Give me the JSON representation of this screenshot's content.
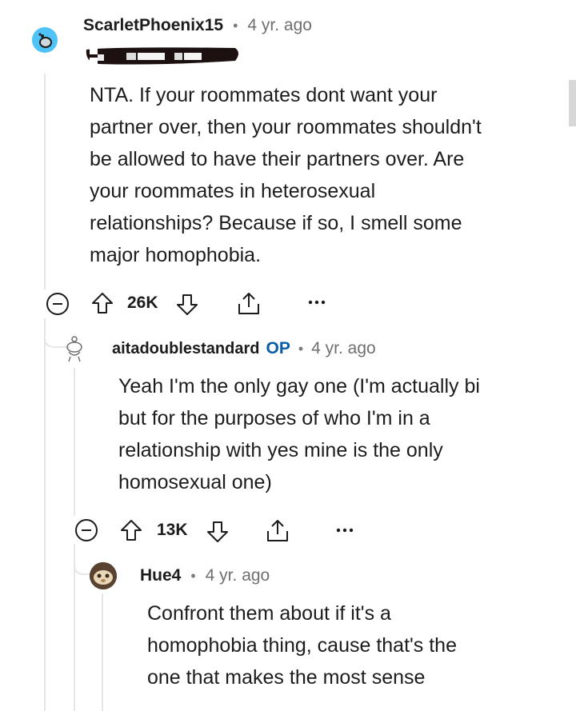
{
  "comments": [
    {
      "author": "ScarletPhoenix15",
      "dot": "•",
      "time": "4 yr. ago",
      "flair_redacted": true,
      "body_lines": [
        "NTA. If your roommates dont want your",
        "partner over, then your roommates shouldn't",
        "be allowed to have their partners over. Are",
        "your roommates in heterosexual",
        "relationships? Because if so, I smell some",
        "major homophobia."
      ],
      "votes": "26K",
      "avatar_color": "#4fc3f7"
    },
    {
      "author": "aitadoublestandard",
      "op_badge": "OP",
      "dot": "•",
      "time": "4 yr. ago",
      "body_lines": [
        "Yeah I'm the only gay one (I'm actually bi",
        "but for the purposes of who I'm in a",
        "relationship with yes mine is the only",
        "homosexual one)"
      ],
      "votes": "13K",
      "op_color": "#0a5ca8"
    },
    {
      "author": "Hue4",
      "dot": "•",
      "time": "4 yr. ago",
      "body_lines": [
        "Confront them about if it's a",
        "homophobia thing, cause that's the",
        "one that makes the most sense"
      ]
    }
  ],
  "icons": {
    "collapse": "minus-circle-icon",
    "upvote": "arrow-up-icon",
    "downvote": "arrow-down-icon",
    "share": "share-icon",
    "more": "ellipsis-icon"
  }
}
